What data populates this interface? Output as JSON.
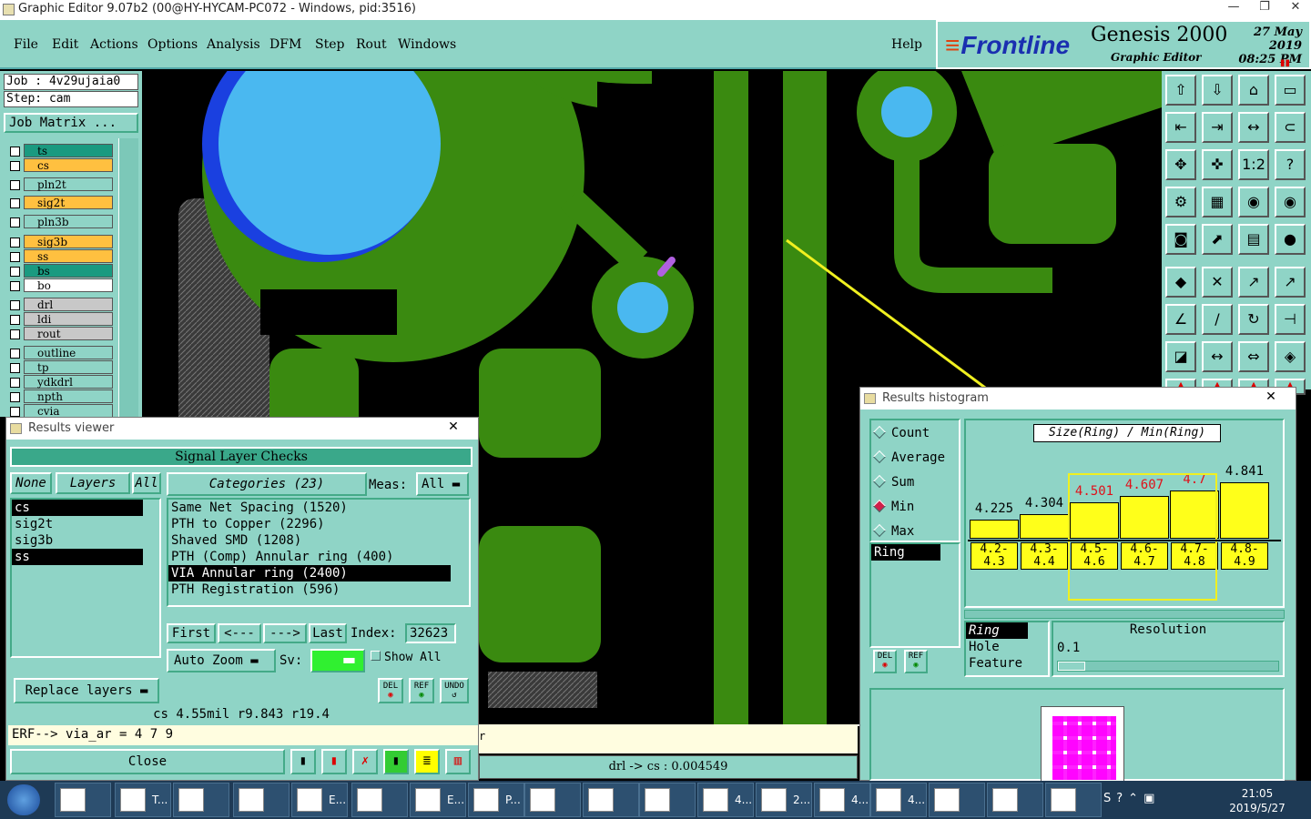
{
  "window": {
    "title": "Graphic Editor 9.07b2 (00@HY-HYCAM-PC072 - Windows, pid:3516)"
  },
  "menu": [
    "File",
    "Edit",
    "Actions",
    "Options",
    "Analysis",
    "DFM",
    "Step",
    "Rout",
    "Windows"
  ],
  "help": "Help",
  "brand": {
    "logo": "Frontline",
    "product": "Genesis 2000",
    "subtitle": "Graphic Editor",
    "date": "27 May 2019",
    "time": "08:25 PM"
  },
  "job": {
    "job": "Job : 4v29ujaia0",
    "step": "Step: cam",
    "matrix_button": "Job Matrix ..."
  },
  "layers": [
    {
      "name": "ts",
      "color": "#1a9a80"
    },
    {
      "name": "cs",
      "color": "#ffc040"
    },
    {
      "name": "pln2t",
      "color": "#8fd4c6"
    },
    {
      "name": "sig2t",
      "color": "#ffc040"
    },
    {
      "name": "pln3b",
      "color": "#8fd4c6"
    },
    {
      "name": "sig3b",
      "color": "#ffc040"
    },
    {
      "name": "ss",
      "color": "#ffc040"
    },
    {
      "name": "bs",
      "color": "#1a9a80"
    },
    {
      "name": "bo",
      "color": "#ffffff"
    },
    {
      "name": "drl",
      "color": "#c8c8c8"
    },
    {
      "name": "ldi",
      "color": "#c8c8c8"
    },
    {
      "name": "rout",
      "color": "#c8c8c8"
    },
    {
      "name": "outline",
      "color": "#8fd4c6"
    },
    {
      "name": "tp",
      "color": "#8fd4c6"
    },
    {
      "name": "ydkdrl",
      "color": "#8fd4c6"
    },
    {
      "name": "npth",
      "color": "#8fd4c6"
    },
    {
      "name": "cvia",
      "color": "#8fd4c6"
    }
  ],
  "results_viewer": {
    "title": "Results viewer",
    "close_x": "✕",
    "heading": "Signal Layer Checks",
    "none_btn": "None",
    "layers_btn": "Layers",
    "all_btn": "All",
    "categories_btn": "Categories (23)",
    "meas_label": "Meas:",
    "meas_value": "All",
    "layer_list": [
      "cs",
      "sig2t",
      "sig3b",
      "ss"
    ],
    "category_list": [
      "Same Net Spacing (1520)",
      "PTH to Copper (2296)",
      "Shaved SMD (1208)",
      "PTH (Comp) Annular ring (400)",
      "VIA Annular ring (2400)",
      "PTH Registration (596)"
    ],
    "first": "First",
    "prev": "<---",
    "next": "--->",
    "last": "Last",
    "index_label": "Index:",
    "index_value": "32623",
    "auto_zoom": "Auto Zoom",
    "sv_label": "Sv:",
    "show_all": "Show All",
    "replace_layers": "Replace layers",
    "del": "DEL",
    "ref": "REF",
    "undo": "UNDO",
    "status": "cs 4.55mil  r9.843  r19.4",
    "erf": "ERF--> via_ar = 4 7 9",
    "close": "Close"
  },
  "histogram": {
    "title": "Results histogram",
    "close_x": "✕",
    "modes": [
      "Count",
      "Average",
      "Sum",
      "Min",
      "Max"
    ],
    "selected_mode": "Min",
    "chart_title": "Size(Ring) / Min(Ring)",
    "list_item": "Ring",
    "attr_list": [
      "Ring",
      "Hole",
      "Feature"
    ],
    "resolution_label": "Resolution",
    "resolution_value": "0.1",
    "del": "DEL",
    "ref": "REF"
  },
  "chart_data": {
    "type": "bar",
    "title": "Size(Ring) / Min(Ring)",
    "categories": [
      "4.2-4.3",
      "4.3-4.4",
      "4.5-4.6",
      "4.6-4.7",
      "4.7-4.8",
      "4.8-4.9"
    ],
    "values": [
      4.225,
      4.304,
      4.501,
      4.607,
      4.7,
      4.841
    ],
    "value_labels": [
      "4.225",
      "4.304",
      "4.501",
      "4.607",
      "4.7",
      "4.841"
    ],
    "highlighted": [
      false,
      false,
      true,
      true,
      true,
      false
    ],
    "bar_color": "#ffff1a",
    "highlight_label_color": "#e0101a",
    "xlabel": "",
    "ylabel": ""
  },
  "canvas": {
    "status": "drl -> cs : 0.004549"
  },
  "taskbar": {
    "items": [
      "T...",
      "E...",
      "P...",
      "E...",
      "4...",
      "2...",
      "4...",
      "4..."
    ],
    "time": "21:05",
    "date": "2019/5/27"
  }
}
